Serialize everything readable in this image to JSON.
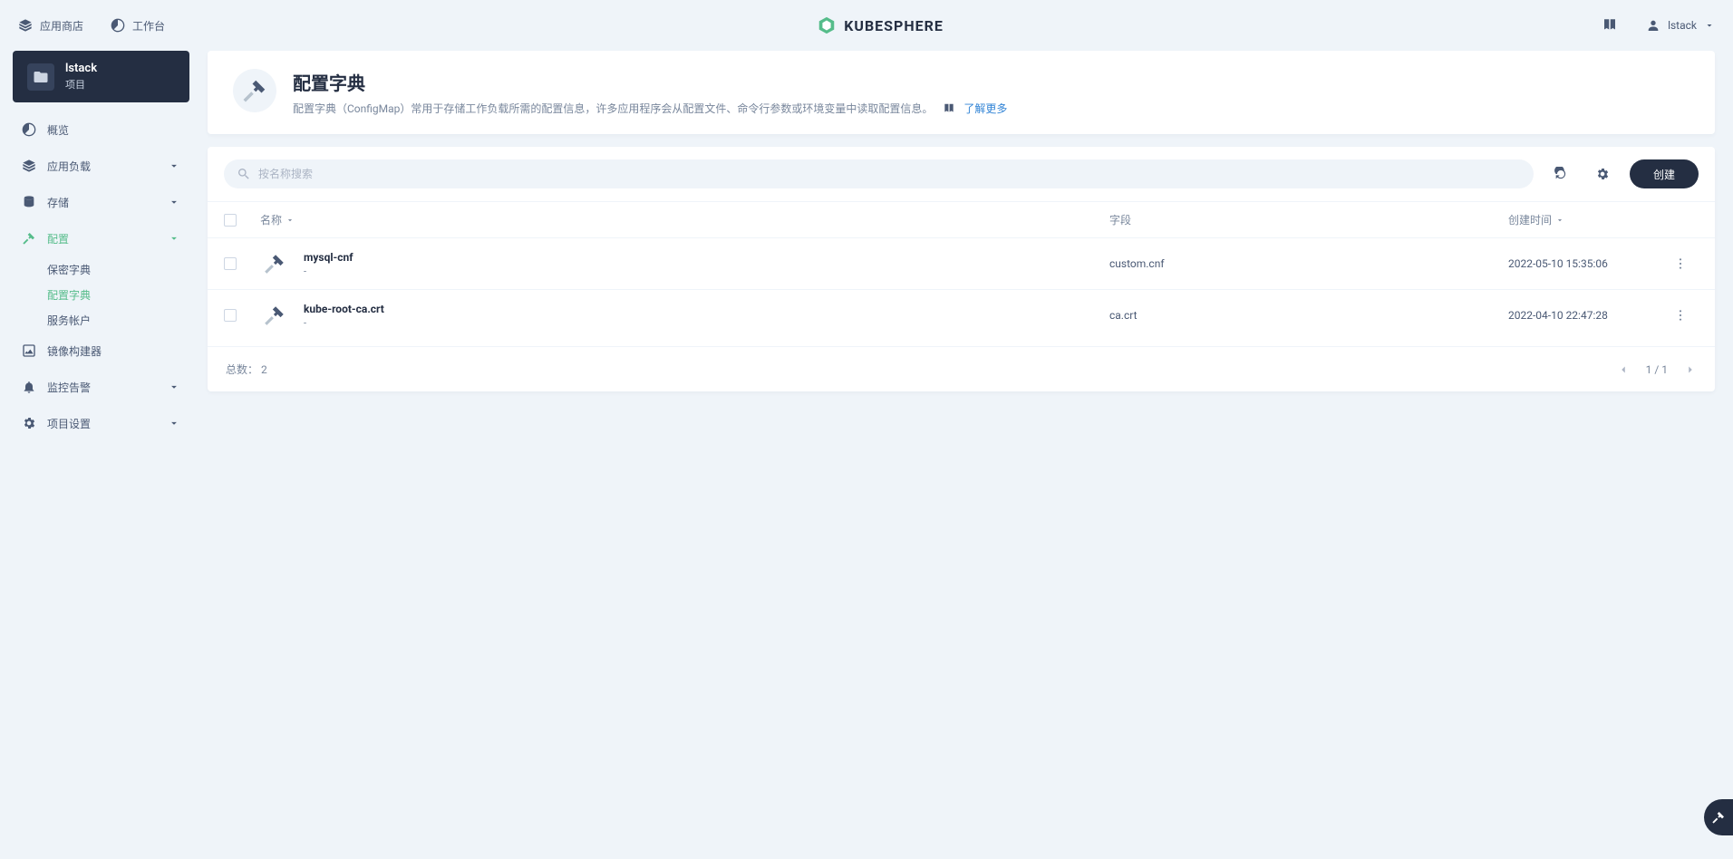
{
  "topbar": {
    "appstore": "应用商店",
    "workbench": "工作台",
    "brand": "KUBESPHERE",
    "user": "lstack"
  },
  "sidebar": {
    "project_name": "lstack",
    "project_type": "项目",
    "nav": {
      "overview": "概览",
      "workloads": "应用负载",
      "storage": "存储",
      "config": "配置",
      "config_children": {
        "secrets": "保密字典",
        "configmaps": "配置字典",
        "serviceaccounts": "服务帐户"
      },
      "image_builder": "镜像构建器",
      "monitoring": "监控告警",
      "project_settings": "项目设置"
    }
  },
  "page": {
    "title": "配置字典",
    "description": "配置字典（ConfigMap）常用于存储工作负载所需的配置信息，许多应用程序会从配置文件、命令行参数或环境变量中读取配置信息。",
    "learn_more": "了解更多",
    "search_placeholder": "按名称搜索",
    "create_button": "创建",
    "columns": {
      "name": "名称",
      "field": "字段",
      "created": "创建时间"
    },
    "rows": [
      {
        "name": "mysql-cnf",
        "desc": "-",
        "field": "custom.cnf",
        "created": "2022-05-10 15:35:06"
      },
      {
        "name": "kube-root-ca.crt",
        "desc": "-",
        "field": "ca.crt",
        "created": "2022-04-10 22:47:28"
      }
    ],
    "total_label": "总数：",
    "total": "2",
    "pager": "1 / 1"
  }
}
